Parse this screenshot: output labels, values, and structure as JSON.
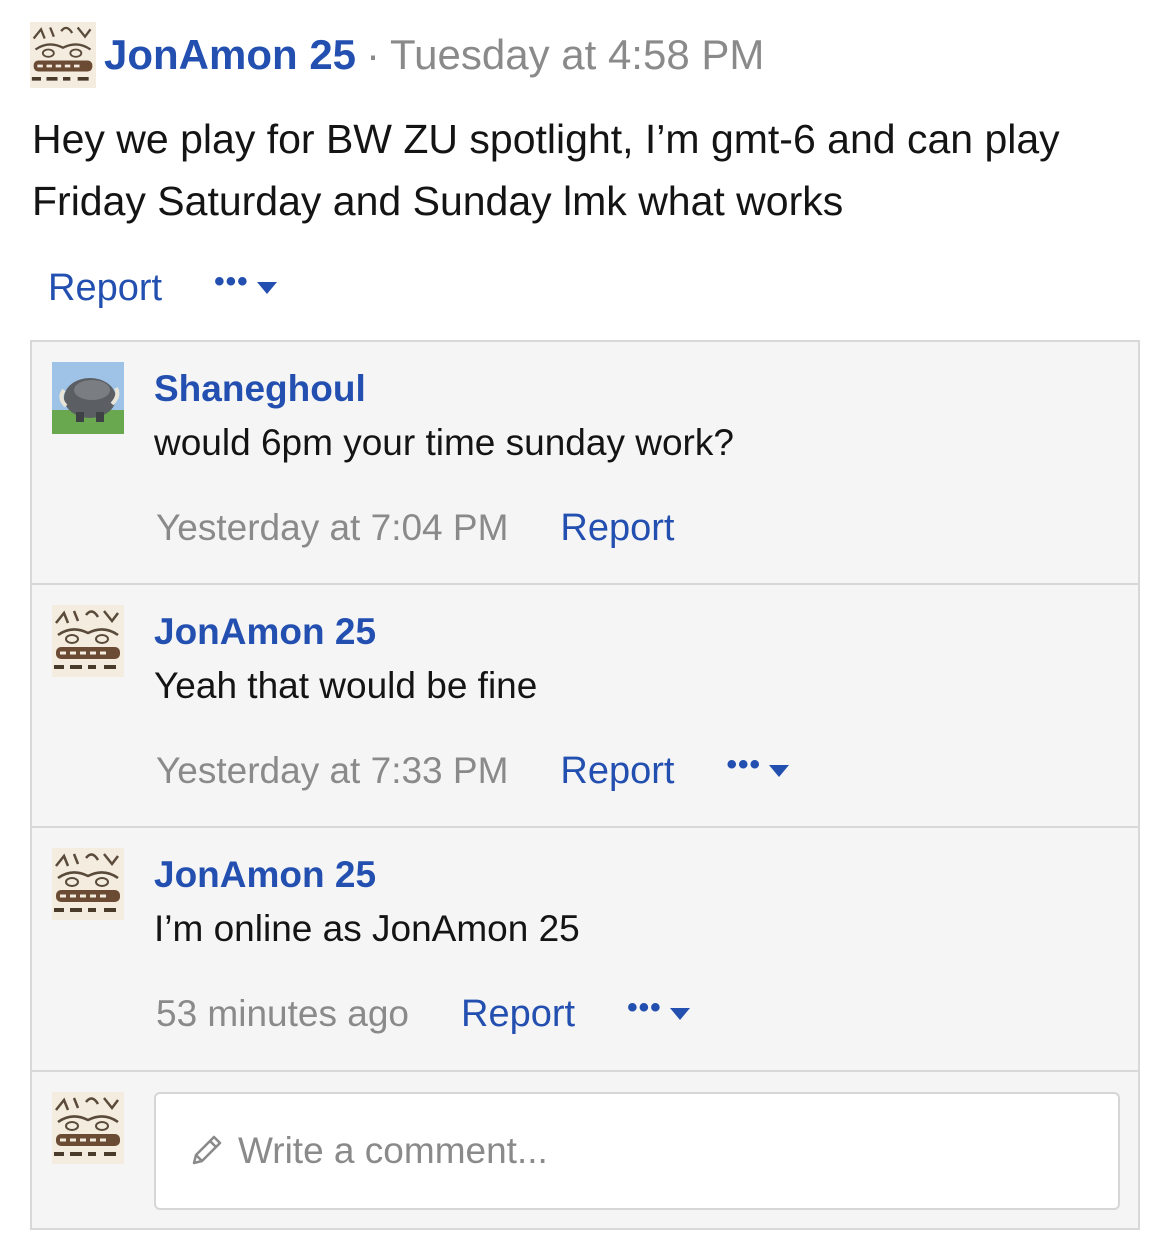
{
  "post": {
    "author": "JonAmon 25",
    "separator": "·",
    "time": "Tuesday at 4:58 PM",
    "body": "Hey we play for BW ZU spotlight, I’m gmt-6 and can play Friday Saturday and Sunday lmk what works",
    "report_label": "Report",
    "more_label": "•••"
  },
  "comments": [
    {
      "author": "Shaneghoul",
      "text": "would 6pm your time sunday work?",
      "time": "Yesterday at 7:04 PM",
      "report_label": "Report"
    },
    {
      "author": "JonAmon 25",
      "text": "Yeah that would be fine",
      "time": "Yesterday at 7:33 PM",
      "report_label": "Report",
      "more_label": "•••"
    },
    {
      "author": "JonAmon 25",
      "text": "I’m online as JonAmon 25",
      "time": "53 minutes ago",
      "report_label": "Report",
      "more_label": "•••"
    }
  ],
  "comment_form": {
    "placeholder": "Write a comment..."
  },
  "colors": {
    "link": "#2350b0",
    "muted": "#8a8a8a",
    "text": "#141414",
    "panel_bg": "#f5f5f5",
    "border": "#d8d8d8"
  },
  "icons": [
    "user-avatar-sketch",
    "user-avatar-pokemon",
    "pencil-icon",
    "more-dots-icon",
    "caret-down-icon"
  ]
}
